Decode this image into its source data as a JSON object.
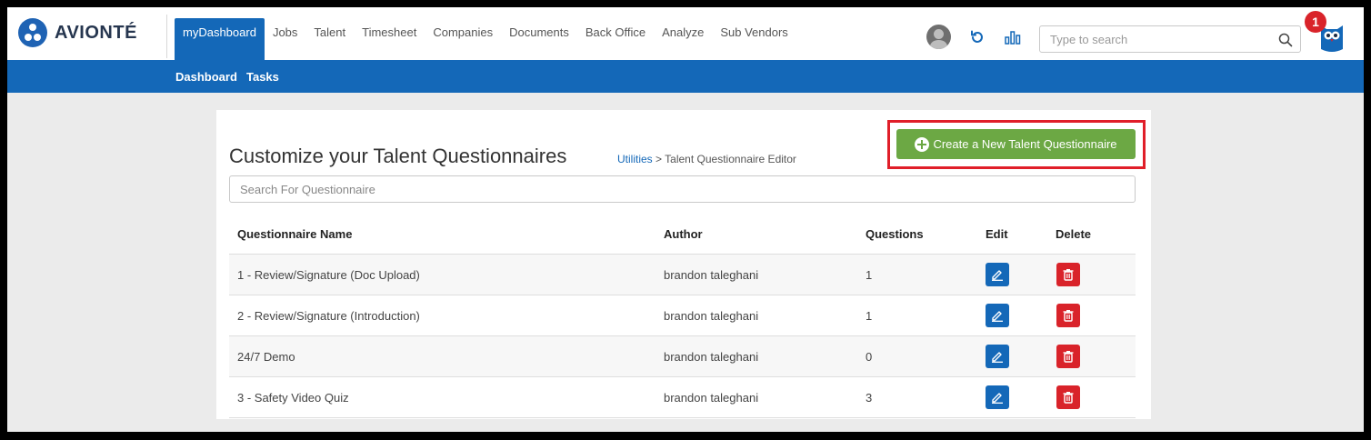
{
  "brand": {
    "name": "AVIONTÉ"
  },
  "nav": {
    "items": [
      {
        "label": "myDashboard",
        "active": true
      },
      {
        "label": "Jobs"
      },
      {
        "label": "Talent"
      },
      {
        "label": "Timesheet"
      },
      {
        "label": "Companies"
      },
      {
        "label": "Documents"
      },
      {
        "label": "Back Office"
      },
      {
        "label": "Analyze"
      },
      {
        "label": "Sub Vendors"
      }
    ]
  },
  "header": {
    "search_placeholder": "Type to search",
    "notification_count": "1",
    "icons": [
      "user-avatar",
      "refresh-icon",
      "analytics-icon",
      "search-icon",
      "owl-icon"
    ]
  },
  "subnav": {
    "items": [
      {
        "label": "Dashboard"
      },
      {
        "label": "Tasks"
      }
    ]
  },
  "page": {
    "title": "Customize your Talent Questionnaires",
    "breadcrumb": {
      "link": "Utilities",
      "separator": ">",
      "current": "Talent Questionnaire Editor"
    },
    "create_button_label": "Create a New Talent Questionnaire",
    "search_placeholder": "Search For Questionnaire"
  },
  "table": {
    "headers": {
      "name": "Questionnaire Name",
      "author": "Author",
      "questions": "Questions",
      "edit": "Edit",
      "delete": "Delete"
    },
    "rows": [
      {
        "name": "1 - Review/Signature (Doc Upload)",
        "author": "brandon taleghani",
        "questions": "1"
      },
      {
        "name": "2 - Review/Signature (Introduction)",
        "author": "brandon taleghani",
        "questions": "1"
      },
      {
        "name": "24/7 Demo",
        "author": "brandon taleghani",
        "questions": "0"
      },
      {
        "name": "3 - Safety Video Quiz",
        "author": "brandon taleghani",
        "questions": "3"
      }
    ]
  },
  "colors": {
    "primary": "#1468b8",
    "success": "#6ca844",
    "danger": "#d9232a",
    "highlight": "#e01e29"
  }
}
